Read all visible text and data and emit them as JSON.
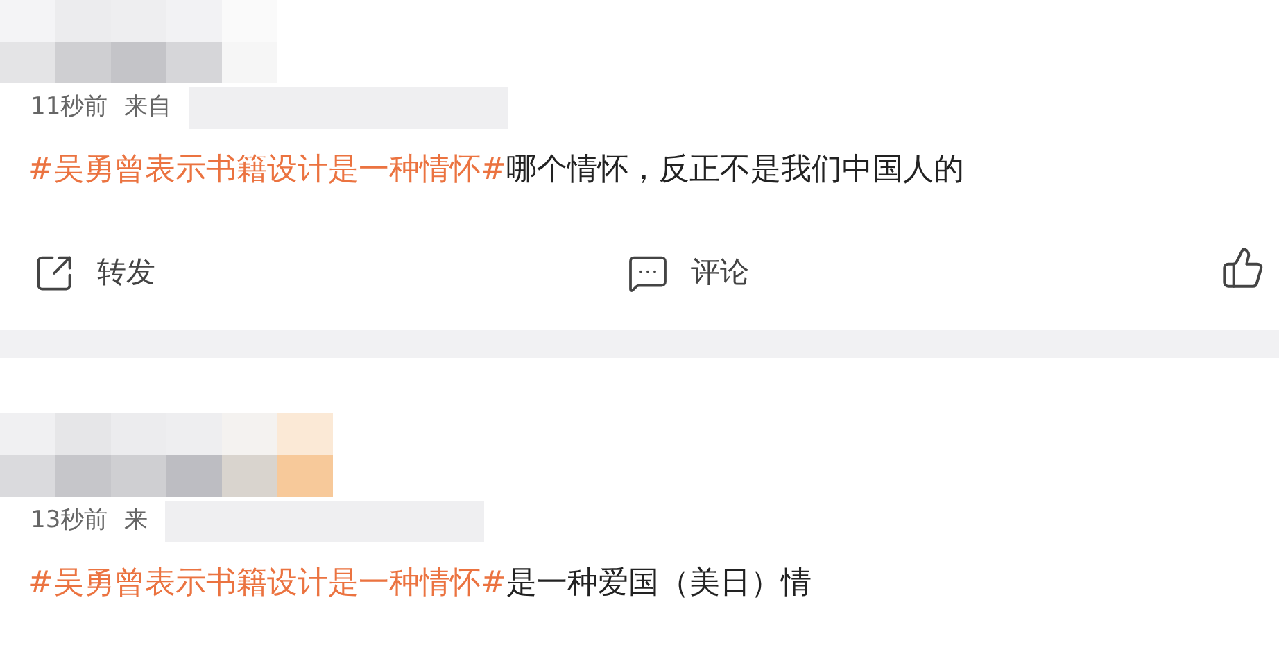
{
  "posts": [
    {
      "time": "11秒前",
      "source": "来自",
      "topic": "#吴勇曾表示书籍设计是一种情怀#",
      "text": "哪个情怀，反正不是我们中国人的",
      "actions": [
        {
          "kind": "repost",
          "label": "转发"
        },
        {
          "kind": "comment",
          "label": "评论"
        },
        {
          "kind": "like"
        }
      ]
    },
    {
      "time": "13秒前",
      "source": "来",
      "topic": "#吴勇曾表示书籍设计是一种情怀#",
      "text": "是一种爱国（美日）情"
    }
  ]
}
